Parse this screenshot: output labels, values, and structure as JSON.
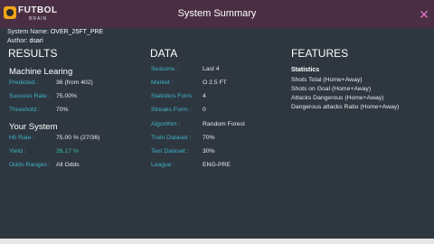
{
  "window": {
    "title": "System Summary",
    "logo_text": "FUTBOL",
    "logo_sub": "BRAIN"
  },
  "meta": {
    "system_name_label": "System Name:",
    "system_name": "OVER_25FT_PRE",
    "author_label": "Author:",
    "author": "dsari"
  },
  "results": {
    "heading": "RESULTS",
    "machine_learning": {
      "heading": "Machine Learing",
      "rows": [
        {
          "label": "Predicted :",
          "value": "36 (from 402)"
        },
        {
          "label": "Success Rate :",
          "value": "75.00%"
        },
        {
          "label": "Threshold :",
          "value": "70%"
        }
      ]
    },
    "your_system": {
      "heading": "Your System",
      "rows": [
        {
          "label": "Hit Rate :",
          "value": "75.00 % (27/36)"
        },
        {
          "label": "Yield :",
          "value": "26.17 %"
        },
        {
          "label": "Odds-Ranges :",
          "value": "All Odds"
        }
      ]
    }
  },
  "data": {
    "heading": "DATA",
    "rows": [
      {
        "label": "Seasons :",
        "value": "Last 4"
      },
      {
        "label": "Market :",
        "value": "O 2.5 FT"
      },
      {
        "label": "Statistics Form :",
        "value": "4"
      },
      {
        "label": "Streaks Form :",
        "value": "0"
      },
      {
        "label": "Algorithm :",
        "value": "Random Forest"
      },
      {
        "label": "Train Dataset :",
        "value": "70%"
      },
      {
        "label": "Test Dataset :",
        "value": "30%"
      },
      {
        "label": "League :",
        "value": "ENG-PRE"
      }
    ]
  },
  "features": {
    "heading": "FEATURES",
    "subheading": "Statistics",
    "items": [
      "Shots Total (Home+Away)",
      "Shots on Goal (Home+Away)",
      "Attacks Dangerous (Home+Away)",
      "Dangerous attacks Ratio (Home+Away)"
    ]
  },
  "colors": {
    "titlebar": "#4a2f44",
    "background": "#2e3740",
    "label": "#3fb4c8",
    "positive": "#2fc39a",
    "close": "#e070c0"
  },
  "icons": {
    "close": "close-icon",
    "logo": "futbol-brain-logo-icon"
  }
}
